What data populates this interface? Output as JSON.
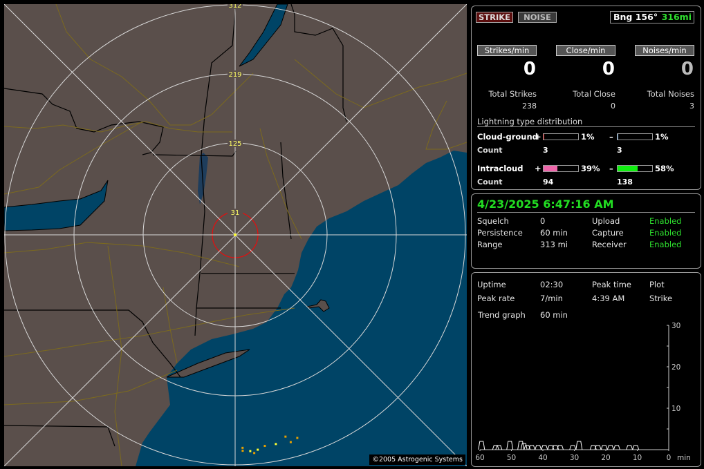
{
  "map": {
    "range_labels": [
      "31",
      "125",
      "219",
      "312"
    ],
    "copyright": "©2005 Astrogenic Systems",
    "colors": {
      "land": "#5a4f4b",
      "water": "#004466",
      "lake": "#1e3d5c",
      "ring": "#d8d8d8",
      "highway": "#7c6a1e",
      "state_border": "#000000",
      "county_border": "#6c6866",
      "close_ring": "#e01010",
      "label": "#ffff66"
    },
    "strikes": [
      {
        "bearing_deg": 178,
        "distance_mi": 290,
        "color": "#e8a000"
      },
      {
        "bearing_deg": 178,
        "distance_mi": 294,
        "color": "#e8a000"
      },
      {
        "bearing_deg": 176,
        "distance_mi": 295,
        "color": "#ffff33"
      },
      {
        "bearing_deg": 175,
        "distance_mi": 298,
        "color": "#e8a000"
      },
      {
        "bearing_deg": 174,
        "distance_mi": 294,
        "color": "#ffff33"
      },
      {
        "bearing_deg": 172,
        "distance_mi": 290,
        "color": "#e8a000"
      },
      {
        "bearing_deg": 169,
        "distance_mi": 290,
        "color": "#ffff33"
      },
      {
        "bearing_deg": 166,
        "distance_mi": 283,
        "color": "#e8a000"
      },
      {
        "bearing_deg": 165,
        "distance_mi": 292,
        "color": "#e8a000"
      },
      {
        "bearing_deg": 163,
        "distance_mi": 289,
        "color": "#e8a000"
      }
    ]
  },
  "header": {
    "strike_label": "STRIKE",
    "noise_label": "NOISE",
    "bearing_label": "Bng 156°",
    "distance_label": "316mi"
  },
  "rates": {
    "strikes_per_min_label": "Strikes/min",
    "close_per_min_label": "Close/min",
    "noises_per_min_label": "Noises/min",
    "strikes_per_min": "0",
    "close_per_min": "0",
    "noises_per_min": "0",
    "total_strikes_label": "Total Strikes",
    "total_close_label": "Total Close",
    "total_noises_label": "Total Noises",
    "total_strikes": "238",
    "total_close": "0",
    "total_noises": "3"
  },
  "distribution": {
    "title": "Lightning type distribution",
    "cloud_ground": {
      "label": "Cloud-ground",
      "pos_sign": "+",
      "neg_sign": "–",
      "pos_pct": "1%",
      "neg_pct": "1%",
      "pos_fraction": 0.01,
      "neg_fraction": 0.01,
      "pos_color": "#e01010",
      "neg_color": "#7fb0e0",
      "count_label": "Count",
      "pos_count": "3",
      "neg_count": "3"
    },
    "intracloud": {
      "label": "Intracloud",
      "pos_sign": "+",
      "neg_sign": "–",
      "pos_pct": "39%",
      "neg_pct": "58%",
      "pos_fraction": 0.39,
      "neg_fraction": 0.58,
      "pos_color": "#ee66aa",
      "neg_color": "#11ee11",
      "count_label": "Count",
      "pos_count": "94",
      "neg_count": "138"
    }
  },
  "status": {
    "datetime": "4/23/2025 6:47:16 AM",
    "rows": [
      {
        "label": "Squelch",
        "value": "0",
        "label2": "Upload",
        "value2": "Enabled"
      },
      {
        "label": "Persistence",
        "value": "60 min",
        "label2": "Capture",
        "value2": "Enabled"
      },
      {
        "label": "Range",
        "value": "313 mi",
        "label2": "Receiver",
        "value2": "Enabled"
      }
    ]
  },
  "stats": {
    "uptime_label": "Uptime",
    "uptime": "02:30",
    "peak_time_label": "Peak time",
    "peak_time": "4:39 AM",
    "plot_label": "Plot",
    "plot": "Strike",
    "peak_rate_label": "Peak rate",
    "peak_rate": "7/min",
    "trend_label": "Trend graph",
    "trend": "60 min"
  },
  "trend_graph": {
    "x_ticks": [
      "60",
      "50",
      "40",
      "30",
      "20",
      "10",
      "0"
    ],
    "x_unit": "min",
    "y_ticks": [
      "10",
      "20",
      "30"
    ],
    "y_max": 30,
    "series_total": [
      {
        "min_ago": 59.5,
        "value": 2
      },
      {
        "min_ago": 55,
        "value": 1
      },
      {
        "min_ago": 54,
        "value": 1
      },
      {
        "min_ago": 50.5,
        "value": 2
      },
      {
        "min_ago": 47,
        "value": 2
      },
      {
        "min_ago": 46,
        "value": 1.5
      },
      {
        "min_ago": 45,
        "value": 1
      },
      {
        "min_ago": 43.5,
        "value": 1
      },
      {
        "min_ago": 41.5,
        "value": 1
      },
      {
        "min_ago": 39.5,
        "value": 1
      },
      {
        "min_ago": 37.5,
        "value": 1
      },
      {
        "min_ago": 36,
        "value": 1
      },
      {
        "min_ago": 34.5,
        "value": 1
      },
      {
        "min_ago": 30.5,
        "value": 1
      },
      {
        "min_ago": 28.5,
        "value": 2
      },
      {
        "min_ago": 24,
        "value": 1
      },
      {
        "min_ago": 22.5,
        "value": 1
      },
      {
        "min_ago": 20.5,
        "value": 1
      },
      {
        "min_ago": 18.5,
        "value": 1
      },
      {
        "min_ago": 16.5,
        "value": 1
      },
      {
        "min_ago": 12.5,
        "value": 1
      },
      {
        "min_ago": 10.5,
        "value": 1
      }
    ]
  }
}
